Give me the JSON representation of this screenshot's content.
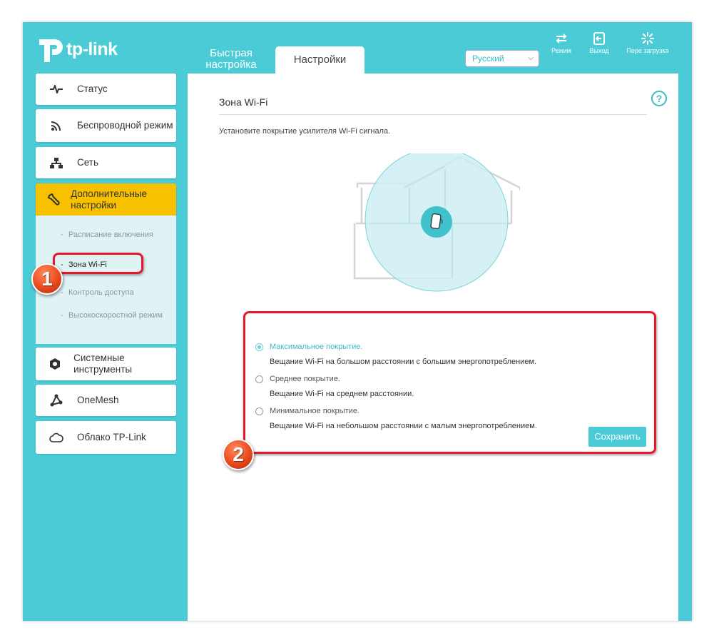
{
  "header": {
    "logo_text": "tp-link",
    "tabs": [
      {
        "label": "Быстрая настройка"
      },
      {
        "label": "Настройки"
      }
    ],
    "language": "Русский",
    "buttons": [
      {
        "label": "Режим",
        "icon": "mode-icon"
      },
      {
        "label": "Выход",
        "icon": "logout-icon"
      },
      {
        "label": "Пере загрузка",
        "icon": "reboot-icon"
      }
    ]
  },
  "sidebar": {
    "items": [
      {
        "label": "Статус",
        "icon": "pulse-icon"
      },
      {
        "label": "Беспроводной режим",
        "icon": "wifi-icon"
      },
      {
        "label": "Сеть",
        "icon": "network-icon"
      },
      {
        "label": "Дополнительные настройки",
        "icon": "wrench-icon",
        "active": true
      },
      {
        "label": "Системные инструменты",
        "icon": "gear-icon"
      },
      {
        "label": "OneMesh",
        "icon": "mesh-icon"
      },
      {
        "label": "Облако TP-Link",
        "icon": "cloud-icon"
      }
    ],
    "submenu": [
      {
        "label": "Расписание включения"
      },
      {
        "label": "Зона Wi-Fi",
        "active": true
      },
      {
        "label": "Контроль доступа"
      },
      {
        "label": "Высокоскоростной режим"
      }
    ]
  },
  "main": {
    "title": "Зона Wi-Fi",
    "help": "?",
    "subtitle": "Установите покрытие усилителя Wi-Fi сигнала.",
    "options": [
      {
        "title": "Максимальное покрытие.",
        "description": "Вещание Wi-Fi на большом расстоянии с большим энергопотреблением.",
        "selected": true
      },
      {
        "title": "Среднее покрытие.",
        "description": "Вещание Wi-Fi на среднем расстоянии.",
        "selected": false
      },
      {
        "title": "Минимальное покрытие.",
        "description": "Вещание Wi-Fi на небольшом расстоянии с малым энергопотреблением.",
        "selected": false
      }
    ],
    "save_label": "Сохранить"
  },
  "annotations": [
    {
      "number": "1"
    },
    {
      "number": "2"
    }
  ],
  "colors": {
    "brand": "#4acbd6",
    "active_nav": "#f8c100",
    "annotation": "#e8152b"
  }
}
